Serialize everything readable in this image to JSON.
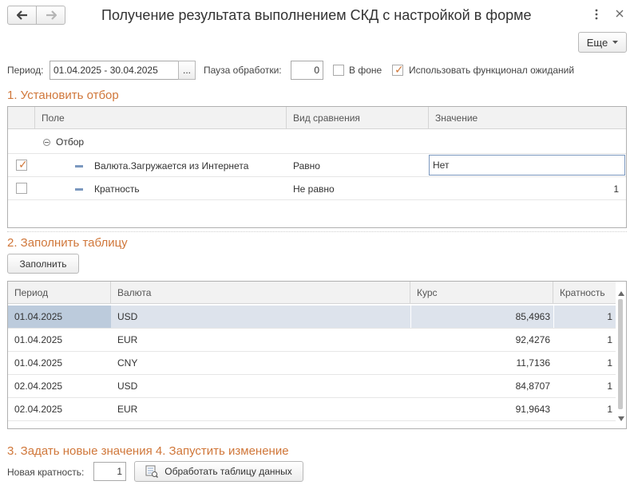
{
  "header": {
    "title": "Получение результата выполнением СКД с настройкой в форме",
    "more_label": "Еще"
  },
  "params": {
    "period_label": "Период:",
    "period_value": "01.04.2025 - 30.04.2025",
    "period_select": "...",
    "pause_label": "Пауза обработки:",
    "pause_value": "0",
    "background_label": "В фоне",
    "background_checked": false,
    "wait_label": "Использовать функционал ожиданий",
    "wait_checked": true
  },
  "section1": {
    "title": "1. Установить отбор",
    "columns": [
      "Поле",
      "Вид сравнения",
      "Значение"
    ],
    "group_label": "Отбор",
    "rows": [
      {
        "checked": true,
        "field": "Валюта.Загружается из Интернета",
        "comparison": "Равно",
        "value": "Нет"
      },
      {
        "checked": false,
        "field": "Кратность",
        "comparison": "Не равно",
        "value": "1"
      }
    ]
  },
  "section2": {
    "title": "2. Заполнить таблицу",
    "fill_button": "Заполнить",
    "columns": [
      "Период",
      "Валюта",
      "Курс",
      "Кратность"
    ],
    "rows": [
      {
        "period": "01.04.2025",
        "currency": "USD",
        "rate": "85,4963",
        "multiplicity": "1"
      },
      {
        "period": "01.04.2025",
        "currency": "EUR",
        "rate": "92,4276",
        "multiplicity": "1"
      },
      {
        "period": "01.04.2025",
        "currency": "CNY",
        "rate": "11,7136",
        "multiplicity": "1"
      },
      {
        "period": "02.04.2025",
        "currency": "USD",
        "rate": "84,8707",
        "multiplicity": "1"
      },
      {
        "period": "02.04.2025",
        "currency": "EUR",
        "rate": "91,9643",
        "multiplicity": "1"
      }
    ]
  },
  "section3": {
    "title": "3. Задать новые значения 4. Запустить изменение",
    "new_mult_label": "Новая кратность:",
    "new_mult_value": "1",
    "process_button": "Обработать таблицу данных"
  },
  "colors": {
    "accent": "#d0773a",
    "selected_row": "#dde3ec",
    "selected_cell": "#bccbdc"
  }
}
